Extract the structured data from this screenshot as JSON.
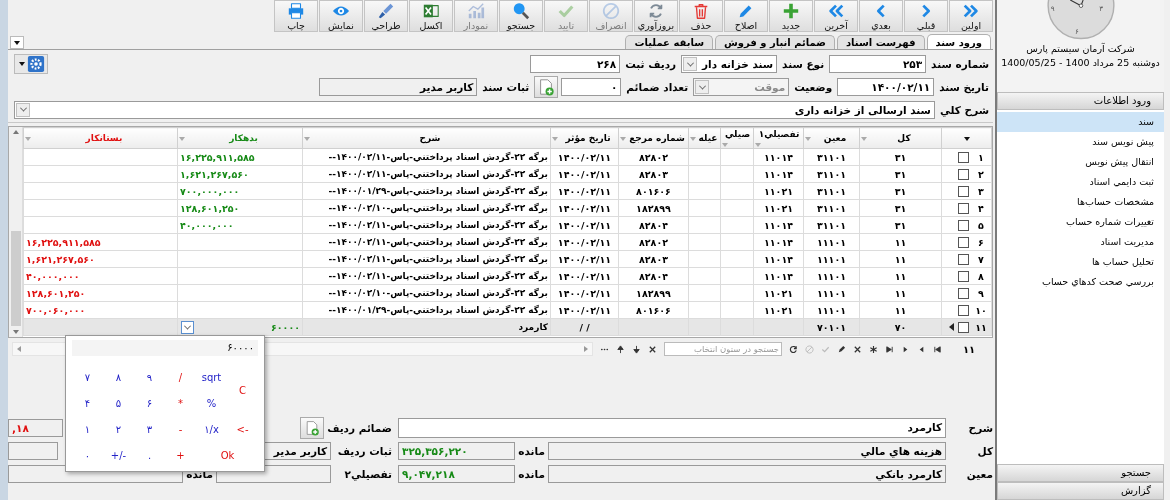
{
  "toolbar": [
    {
      "label": "اولين",
      "disabled": false
    },
    {
      "label": "قبلي",
      "disabled": false
    },
    {
      "label": "بعدي",
      "disabled": false
    },
    {
      "label": "آخرين",
      "disabled": false
    },
    {
      "label": "جديد",
      "disabled": false
    },
    {
      "label": "اصلاح",
      "disabled": false
    },
    {
      "label": "حذف",
      "disabled": false
    },
    {
      "label": "بروزآوري",
      "disabled": false
    },
    {
      "label": "انصراف",
      "disabled": true
    },
    {
      "label": "تاييد",
      "disabled": true
    },
    {
      "label": "جستجو",
      "disabled": false
    },
    {
      "label": "نمودار",
      "disabled": true
    },
    {
      "label": "اكسل",
      "disabled": false
    },
    {
      "label": "طراحي",
      "disabled": false
    },
    {
      "label": "نمايش",
      "disabled": false
    },
    {
      "label": "چاپ",
      "disabled": false
    }
  ],
  "tabs": [
    {
      "label": "ورود سند",
      "selected": true
    },
    {
      "label": "فهرست اسناد",
      "selected": false
    },
    {
      "label": "ضمائم انبار و فروش",
      "selected": false
    },
    {
      "label": "سابقه عمليات",
      "selected": false
    }
  ],
  "document": {
    "number": {
      "label": "شماره سند",
      "value": "۲۵۳"
    },
    "type": {
      "label": "نوع سند",
      "value": "سند خزانه دار"
    },
    "registry_row": {
      "label": "رديف ثبت",
      "value": "۲۶۸"
    },
    "date": {
      "label": "تاريخ سند",
      "value": "۱۴۰۰/۰۲/۱۱"
    },
    "status": {
      "label": "وضعيت",
      "value": "موقت",
      "disabled": true
    },
    "attachments": {
      "label": "تعداد ضمائم",
      "value": "۰"
    },
    "recorder": {
      "label": "ثبات سند",
      "value": "كاربر مدير"
    },
    "description": {
      "label": "شرح كلي",
      "value": "سند ارسالي از خزانه داري"
    }
  },
  "table": {
    "columns": [
      {
        "label": "كل",
        "kind": "text"
      },
      {
        "label": "معين",
        "kind": "text"
      },
      {
        "label": "تفصيلي۱",
        "kind": "text"
      },
      {
        "label": "صيلي",
        "kind": "text"
      },
      {
        "label": "عيله",
        "kind": "text"
      },
      {
        "label": "شماره مرجع",
        "kind": "text"
      },
      {
        "label": "تاريخ مؤثر",
        "kind": "text"
      },
      {
        "label": "شرح",
        "kind": "description"
      },
      {
        "label": "بدهكار",
        "kind": "debit"
      },
      {
        "label": "بستانكار",
        "kind": "credit"
      }
    ],
    "rows": [
      {
        "number": "۱",
        "checked": false,
        "current": false,
        "cells": [
          "۳۱",
          "۳۱۱۰۱",
          "۱۱۰۱۴",
          null,
          null,
          "۸۲۸۰۲",
          "۱۴۰۰/۰۲/۱۱",
          "برگه ۲۲-گردش اسناد پرداختني-پاس-۱۴۰۰/۰۲/۱۱--",
          "۱۶,۲۲۵,۹۱۱,۵۸۵",
          null
        ]
      },
      {
        "number": "۲",
        "checked": false,
        "current": false,
        "cells": [
          "۳۱",
          "۳۱۱۰۱",
          "۱۱۰۱۴",
          null,
          null,
          "۸۲۸۰۳",
          "۱۴۰۰/۰۲/۱۱",
          "برگه ۲۲-گردش اسناد پرداختني-پاس-۱۴۰۰/۰۲/۱۱--",
          "۱,۶۲۱,۲۶۷,۵۶۰",
          null
        ]
      },
      {
        "number": "۳",
        "checked": false,
        "current": false,
        "cells": [
          "۳۱",
          "۳۱۱۰۱",
          "۱۱۰۲۱",
          null,
          null,
          "۸۰۱۶۰۶",
          "۱۴۰۰/۰۲/۱۱",
          "برگه ۲۲-گردش اسناد پرداختني-پاس-۱۴۰۰/۰۱/۲۹--",
          "۷۰۰,۰۰۰,۰۰۰",
          null
        ]
      },
      {
        "number": "۴",
        "checked": false,
        "current": false,
        "cells": [
          "۳۱",
          "۳۱۱۰۱",
          "۱۱۰۲۱",
          null,
          null,
          "۱۸۲۸۹۹",
          "۱۴۰۰/۰۲/۱۱",
          "برگه ۲۲-گردش اسناد پرداختني-پاس-۱۴۰۰/۰۲/۱۰--",
          "۱۲۸,۶۰۱,۲۵۰",
          null
        ]
      },
      {
        "number": "۵",
        "checked": false,
        "current": false,
        "cells": [
          "۳۱",
          "۳۱۱۰۱",
          "۱۱۰۱۴",
          null,
          null,
          "۸۲۸۰۴",
          "۱۴۰۰/۰۲/۱۱",
          "برگه ۲۲-گردش اسناد پرداختني-پاس-۱۴۰۰/۰۲/۱۱--",
          "۴۰,۰۰۰,۰۰۰",
          null
        ]
      },
      {
        "number": "۶",
        "checked": false,
        "current": false,
        "cells": [
          "۱۱",
          "۱۱۱۰۱",
          "۱۱۰۱۴",
          null,
          null,
          "۸۲۸۰۲",
          "۱۴۰۰/۰۲/۱۱",
          "برگه ۲۲-گردش اسناد پرداختني-پاس-۱۴۰۰/۰۲/۱۱--",
          null,
          "۱۶,۲۲۵,۹۱۱,۵۸۵"
        ]
      },
      {
        "number": "۷",
        "checked": false,
        "current": false,
        "cells": [
          "۱۱",
          "۱۱۱۰۱",
          "۱۱۰۱۴",
          null,
          null,
          "۸۲۸۰۳",
          "۱۴۰۰/۰۲/۱۱",
          "برگه ۲۲-گردش اسناد پرداختني-پاس-۱۴۰۰/۰۲/۱۱--",
          null,
          "۱,۶۲۱,۲۶۷,۵۶۰"
        ]
      },
      {
        "number": "۸",
        "checked": false,
        "current": false,
        "cells": [
          "۱۱",
          "۱۱۱۰۱",
          "۱۱۰۱۴",
          null,
          null,
          "۸۲۸۰۴",
          "۱۴۰۰/۰۲/۱۱",
          "برگه ۲۲-گردش اسناد پرداختني-پاس-۱۴۰۰/۰۲/۱۱--",
          null,
          "۴۰,۰۰۰,۰۰۰"
        ]
      },
      {
        "number": "۹",
        "checked": false,
        "current": false,
        "cells": [
          "۱۱",
          "۱۱۱۰۱",
          "۱۱۰۲۱",
          null,
          null,
          "۱۸۲۸۹۹",
          "۱۴۰۰/۰۲/۱۱",
          "برگه ۲۲-گردش اسناد پرداختني-پاس-۱۴۰۰/۰۲/۱۰--",
          null,
          "۱۲۸,۶۰۱,۲۵۰"
        ]
      },
      {
        "number": "۱۰",
        "checked": false,
        "current": false,
        "cells": [
          "۱۱",
          "۱۱۱۰۱",
          "۱۱۰۲۱",
          null,
          null,
          "۸۰۱۶۰۶",
          "۱۴۰۰/۰۲/۱۱",
          "برگه ۲۲-گردش اسناد پرداختني-پاس-۱۴۰۰/۰۱/۲۹--",
          null,
          "۷۰۰,۰۶۰,۰۰۰"
        ]
      },
      {
        "number": "۱۱",
        "checked": false,
        "current": true,
        "cells": [
          "۷۰",
          "۷۰۱۰۱",
          null,
          null,
          null,
          null,
          "/ /",
          "كارمرد",
          "۶۰۰۰۰",
          null
        ]
      }
    ]
  },
  "pager": {
    "record": "۱۱",
    "search_placeholder": "جستجو در ستون انتخاب"
  },
  "calculator": {
    "display": "۶۰۰۰۰",
    "rows": [
      [
        {
          "label": "C",
          "kind": "clear"
        },
        {
          "label": "sqrt",
          "kind": "digit"
        },
        {
          "label": "/",
          "kind": "op"
        },
        {
          "label": "۹",
          "kind": "digit"
        },
        {
          "label": "۸",
          "kind": "digit"
        },
        {
          "label": "۷",
          "kind": "digit"
        }
      ],
      [
        "",
        {
          "label": "%",
          "kind": "digit"
        },
        {
          "label": "*",
          "kind": "op"
        },
        {
          "label": "۶",
          "kind": "digit"
        },
        {
          "label": "۵",
          "kind": "digit"
        },
        {
          "label": "۴",
          "kind": "digit"
        }
      ],
      [
        {
          "label": "<-",
          "kind": "op"
        },
        {
          "label": "۱/x",
          "kind": "digit"
        },
        {
          "label": "-",
          "kind": "op"
        },
        {
          "label": "۳",
          "kind": "digit"
        },
        {
          "label": "۲",
          "kind": "digit"
        },
        {
          "label": "۱",
          "kind": "digit"
        }
      ],
      [
        {
          "label": "Ok",
          "kind": "ok"
        },
        "",
        {
          "label": "+",
          "kind": "op"
        },
        {
          "label": ".",
          "kind": "digit"
        },
        {
          "label": "+/-",
          "kind": "digit"
        },
        {
          "label": "۰",
          "kind": "digit"
        }
      ]
    ]
  },
  "row_detail": {
    "description": {
      "label": "شرح",
      "value": "كارمرد"
    },
    "accounts": [
      {
        "label": "كل",
        "value": "هزينه هاي مالي",
        "balance_label": "مانده",
        "balance": "۳۲۵,۳۵۶,۲۲۰"
      },
      {
        "label": "معين",
        "value": "كارمرد بانكي",
        "balance_label": "مانده",
        "balance": "۹,۰۴۷,۲۱۸"
      }
    ],
    "attachments_label": "ضمائم رديف",
    "row_total": "۱۸,",
    "recorder": {
      "label": "ثبات رديف",
      "value": "كاربر مدير"
    },
    "detail2": {
      "label": "تفصيلي۲",
      "balance_label": "مانده"
    }
  },
  "sidebar": {
    "clock_numerals": [
      "۹",
      "۳",
      "۶"
    ],
    "company": "شركت آرمان سيستم پارس",
    "date": "دوشنبه 25 مرداد 1400 - 1400/05/25",
    "section": "ورود اطلاعات",
    "items": [
      {
        "label": "سند",
        "selected": true
      },
      {
        "label": "پيش نويس سند",
        "selected": false
      },
      {
        "label": "انتقال پيش نويس",
        "selected": false
      },
      {
        "label": "ثبت دايمي اسناد",
        "selected": false
      },
      {
        "label": "مشخصات حساب‌ها",
        "selected": false
      },
      {
        "label": "تغييرات شماره حساب",
        "selected": false
      },
      {
        "label": "مديريت اسناد",
        "selected": false
      },
      {
        "label": "تحليل حساب ها",
        "selected": false
      },
      {
        "label": "بررسي صحت كدهاي حساب",
        "selected": false
      }
    ],
    "bottom_sections": [
      "جستجو",
      "گزارش"
    ]
  }
}
